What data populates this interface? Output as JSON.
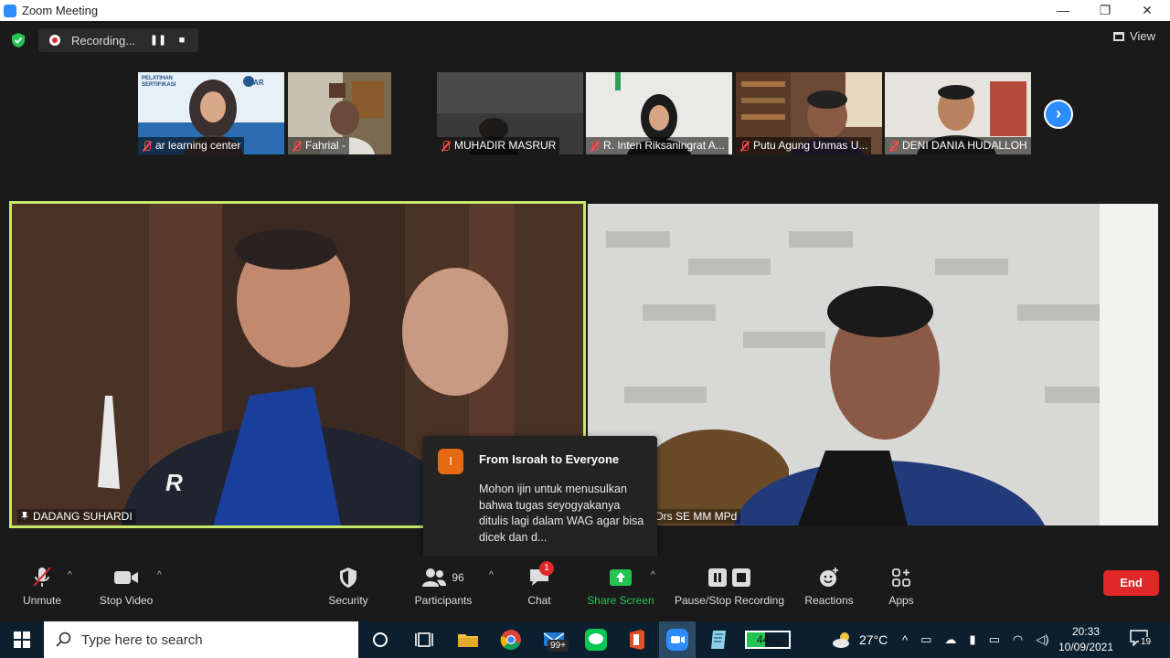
{
  "window": {
    "title": "Zoom Meeting",
    "minimize": "—",
    "restore": "❐",
    "close": "✕"
  },
  "recording": {
    "label": "Recording...",
    "pause": "❚❚",
    "stop": "■"
  },
  "view": {
    "label": "View"
  },
  "participants_strip": [
    {
      "name": "ar learning center",
      "muted": true
    },
    {
      "name": "Fahrial -",
      "muted": true
    },
    {
      "name": "MUHADIR MASRUR",
      "muted": true
    },
    {
      "name": "R. Inten Riksaningrat A...",
      "muted": true
    },
    {
      "name": "Putu Agung Unmas U...",
      "muted": true
    },
    {
      "name": "DENI DANIA HUDALLOH",
      "muted": true
    }
  ],
  "thumb1_banner": "PELATIHAN SERTIFIKASI",
  "next_glyph": "›",
  "main_videos": {
    "left": {
      "name": "DADANG SUHARDI",
      "jacket_logo": "R"
    },
    "right": {
      "name": "Drs SE MM MPd"
    }
  },
  "chat_popup": {
    "avatar_letter": "I",
    "from": "From Isroah to Everyone",
    "message": "Mohon ijin untuk menusulkan bahwa tugas seyogyakanya ditulis lagi dalam WAG agar bisa dicek dan d..."
  },
  "toolbar": {
    "unmute": "Unmute",
    "stop_video": "Stop Video",
    "security": "Security",
    "participants": "Participants",
    "participants_count": "96",
    "chat": "Chat",
    "chat_badge": "1",
    "share_screen": "Share Screen",
    "pause_stop_recording": "Pause/Stop Recording",
    "reactions": "Reactions",
    "apps": "Apps",
    "end": "End",
    "caret": "^"
  },
  "taskbar": {
    "search_placeholder": "Type here to search",
    "mail_badge": "99+",
    "battery": "44%",
    "weather": "27°C",
    "time": "20:33",
    "date": "10/09/2021",
    "notifications": "19"
  },
  "colors": {
    "zoom_blue": "#2D8CFF",
    "active_speaker_border": "#c8e86b",
    "end_red": "#e02828",
    "share_green": "#23c552"
  }
}
